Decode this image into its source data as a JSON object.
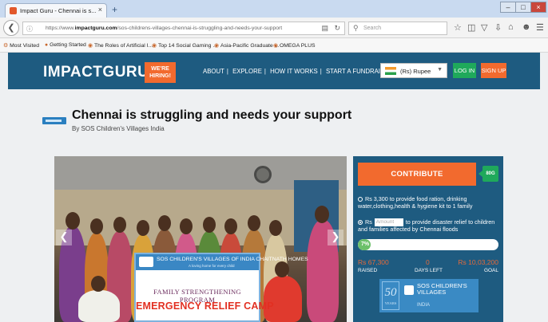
{
  "browser": {
    "tab_title": "Impact Guru - Chennai is s...",
    "tab_close": "×",
    "new_tab": "+",
    "url_prefix": "https://www.",
    "url_domain": "impactguru.com",
    "url_path": "/sos-childrens-villages-chennai-is-struggling-and-needs-your-support",
    "search_placeholder": "Search",
    "bookmarks": [
      "Most Visited",
      "Getting Started",
      "The Roles of Artificial I...",
      "Top 14 Social Gaming ...",
      "Asia-Pacific Graduate ...",
      "OMEGA PLUS"
    ]
  },
  "header": {
    "logo": "IMPACTGURU",
    "hiring": "WE'RE HIRING!",
    "nav": [
      "ABOUT",
      "EXPLORE",
      "HOW IT WORKS",
      "START A FUNDRAISER"
    ],
    "nav_sep": "|",
    "currency": "(Rs) Rupee",
    "login": "LOG IN",
    "signup": "SIGN UP",
    "colors": {
      "header_bg": "#1e5b80",
      "accent_orange": "#f26a2e",
      "accent_green": "#1fa95b"
    }
  },
  "campaign": {
    "title": "Chennai is struggling and needs your support",
    "by": "By SOS Children's Villages India"
  },
  "photo": {
    "banner_line1": "SOS CHILDREN'S VILLAGES OF INDIA CHAITNATH HOMES",
    "banner_line2": "A loving home for every child",
    "banner_program": "FAMILY STRENGTHENING PROGRAM",
    "banner_camp": "EMERGENCY RELIEF CAMP",
    "prev_icon": "chevron-left-icon",
    "next_icon": "chevron-right-icon"
  },
  "donation": {
    "contribute": "CONTRIBUTE",
    "badge": "80G",
    "option1": "Rs 3,300 to provide food ration, drinking water,clothing,health & hygiene kit to 1 family",
    "option2_prefix": "Rs",
    "amount_placeholder": "Amount",
    "option2_suffix": "to provide disaster relief to children and families affected by Chennai floods",
    "progress_label": "7%",
    "progress_value": 0.07,
    "raised_value": "Rs 67,300",
    "raised_label": "RAISED",
    "days_value": "0",
    "days_label": "DAYS LEFT",
    "goal_value": "Rs 10,03,200",
    "goal_label": "GOAL"
  },
  "org": {
    "years_number": "50",
    "years_label": "YEARS",
    "name": "SOS CHILDREN'S VILLAGES",
    "country": "INDIA"
  }
}
